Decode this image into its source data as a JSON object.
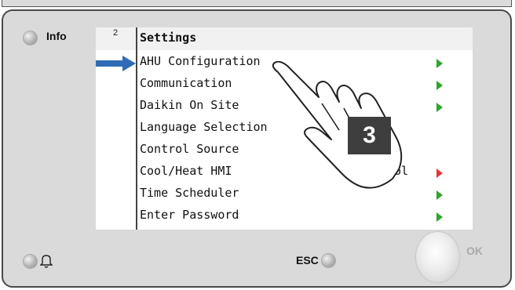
{
  "info_label": "Info",
  "page_number": "2",
  "screen_title": "Settings",
  "menu_items": [
    {
      "label": "AHU Configuration",
      "arrow": "green"
    },
    {
      "label": "Communication",
      "arrow": "green"
    },
    {
      "label": "Daikin On Site",
      "arrow": "green"
    },
    {
      "label": "Language Selection",
      "arrow": "none"
    },
    {
      "label": "Control Source",
      "arrow": "none"
    },
    {
      "label": "Cool/Heat HMI",
      "arrow": "red",
      "value_fragment": "ol"
    },
    {
      "label": "Time Scheduler",
      "arrow": "green"
    },
    {
      "label": "Enter Password",
      "arrow": "green"
    }
  ],
  "esc_label": "ESC",
  "ok_label": "OK",
  "step_badge": "3",
  "icons": {
    "bell": "bell-icon",
    "pointer_hand": "pointing-hand-icon",
    "selection": "right-arrow-icon"
  },
  "colors": {
    "accent_arrow": "#2f6cb5",
    "green_arrow": "#2ea52a",
    "red_arrow": "#e0393b"
  }
}
